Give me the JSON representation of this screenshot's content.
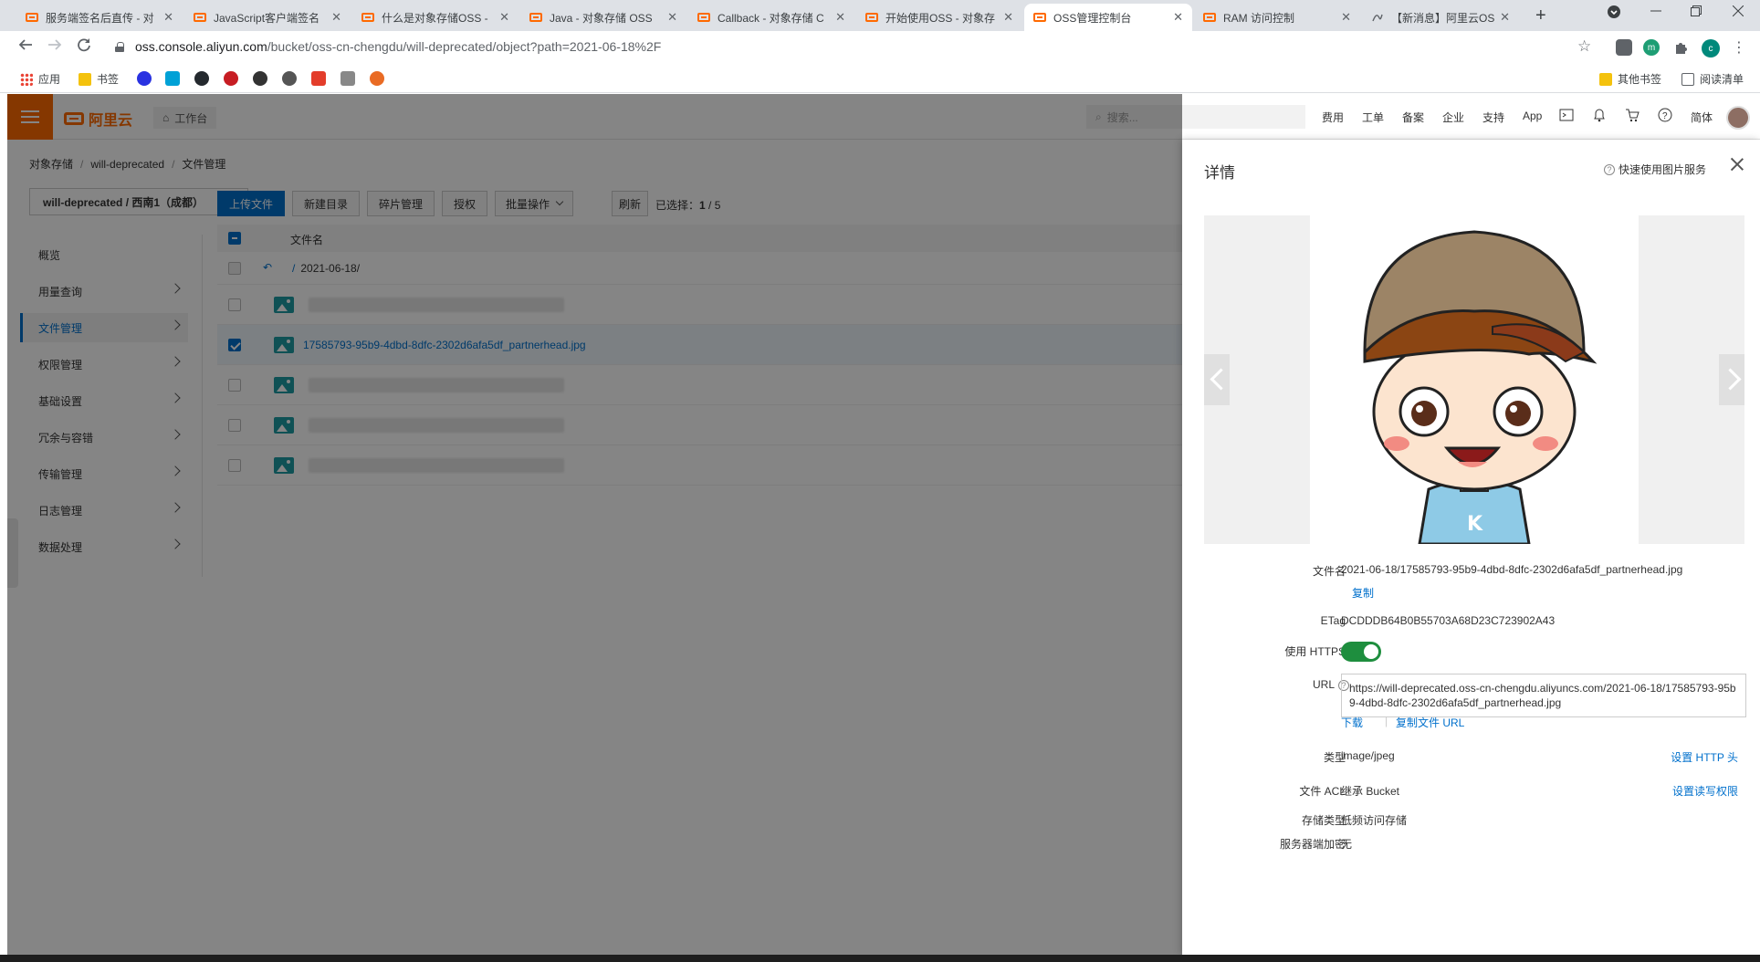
{
  "browser": {
    "tabs": [
      {
        "title": "服务端签名后直传 - 对"
      },
      {
        "title": "JavaScript客户端签名"
      },
      {
        "title": "什么是对象存储OSS -"
      },
      {
        "title": "Java - 对象存储 OSS"
      },
      {
        "title": "Callback - 对象存储 C"
      },
      {
        "title": "开始使用OSS - 对象存"
      },
      {
        "title": "OSS管理控制台"
      },
      {
        "title": "RAM 访问控制"
      },
      {
        "title": "【新消息】阿里云OSS"
      }
    ],
    "new_tab": "+",
    "address": {
      "host": "oss.console.aliyun.com",
      "path": "/bucket/oss-cn-chengdu/will-deprecated/object?path=2021-06-18%2F"
    },
    "profile_letter": "c",
    "ext_letter": "m",
    "bookmarks": [
      {
        "label": "应用"
      },
      {
        "label": "书签"
      }
    ],
    "other_bookmarks": "其他书签",
    "reading_list": "阅读清单"
  },
  "topnav": {
    "logo_text": "阿里云",
    "workbench": "工作台",
    "search_placeholder": "搜索...",
    "links": [
      "费用",
      "工单",
      "备案",
      "企业",
      "支持",
      "App"
    ],
    "lang": "简体"
  },
  "breadcrumb": {
    "items": [
      "对象存储",
      "will-deprecated",
      "文件管理"
    ],
    "separator": "/"
  },
  "bucket_selector": "will-deprecated / 西南1（成都）",
  "sidebar": {
    "items": [
      {
        "label": "概览"
      },
      {
        "label": "用量查询"
      },
      {
        "label": "文件管理"
      },
      {
        "label": "权限管理"
      },
      {
        "label": "基础设置"
      },
      {
        "label": "冗余与容错"
      },
      {
        "label": "传输管理"
      },
      {
        "label": "日志管理"
      },
      {
        "label": "数据处理"
      }
    ]
  },
  "toolbar": {
    "upload": "上传文件",
    "new_dir": "新建目录",
    "fragments": "碎片管理",
    "authorize": "授权",
    "batch": "批量操作",
    "refresh": "刷新",
    "selected_label": "已选择：",
    "selected_count": "1",
    "total_sep": " / ",
    "total_count": "5"
  },
  "table": {
    "col_name": "文件名",
    "back_path": "2021-06-18/",
    "back_prefix": "/",
    "selected_file": "17585793-95b9-4dbd-8dfc-2302d6afa5df_partnerhead.jpg"
  },
  "drawer": {
    "title": "详情",
    "help_link": "快速使用图片服务",
    "fields": {
      "filename_label": "文件名",
      "filename": "2021-06-18/17585793-95b9-4dbd-8dfc-2302d6afa5df_partnerhead.jpg",
      "copy": "复制",
      "etag_label": "ETag",
      "etag": "DCDDDB64B0B55703A68D23C723902A43",
      "https_label": "使用 HTTPS",
      "https_on": true,
      "url_label": "URL",
      "url": "https://will-deprecated.oss-cn-chengdu.aliyuncs.com/2021-06-18/17585793-95b9-4dbd-8dfc-2302d6afa5df_partnerhead.jpg",
      "download": "下载",
      "link_sep": "|",
      "copy_url": "复制文件 URL",
      "type_label": "类型",
      "type": "image/jpeg",
      "set_http_header": "设置 HTTP 头",
      "acl_label": "文件 ACL",
      "acl": "继承 Bucket",
      "set_acl": "设置读写权限",
      "storage_label": "存储类型",
      "storage": "低频访问存储",
      "encrypt_label": "服务器端加密",
      "encrypt": "无"
    },
    "preview_cap_letter": "K"
  },
  "colors": {
    "brand": "#ff6a00",
    "link": "#0070cc",
    "toggle_on": "#1e8e3e"
  }
}
